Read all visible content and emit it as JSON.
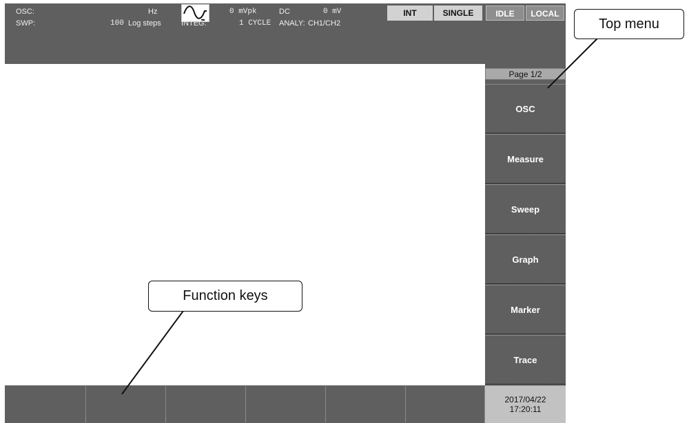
{
  "status": {
    "osc_label": "OSC:",
    "osc_unit": "Hz",
    "amplitude": "0 mVpk",
    "dc_label": "DC",
    "dc_value": "0 mV",
    "swp_label": "SWP:",
    "swp_steps": "100",
    "swp_unit": "Log steps",
    "integ_label": "INTEG:",
    "integ_value": "1 CYCLE",
    "analy_label": "ANALY:",
    "analy_value": "CH1/CH2",
    "waveform_icon": "sine-wave-icon",
    "flags": {
      "int": "INT",
      "single": "SINGLE",
      "idle": "IDLE",
      "local": "LOCAL"
    }
  },
  "menu": {
    "page": "Page 1/2",
    "items": [
      "OSC",
      "Measure",
      "Sweep",
      "Graph",
      "Marker",
      "Trace"
    ]
  },
  "clock": {
    "date": "2017/04/22",
    "time": "17:20:11"
  },
  "function_keys": [
    "",
    "",
    "",
    "",
    "",
    ""
  ],
  "callouts": {
    "top_menu": "Top menu",
    "function_keys": "Function keys"
  },
  "colors": {
    "panel": "#5a5a5a",
    "plot_background": "#ffffff"
  }
}
